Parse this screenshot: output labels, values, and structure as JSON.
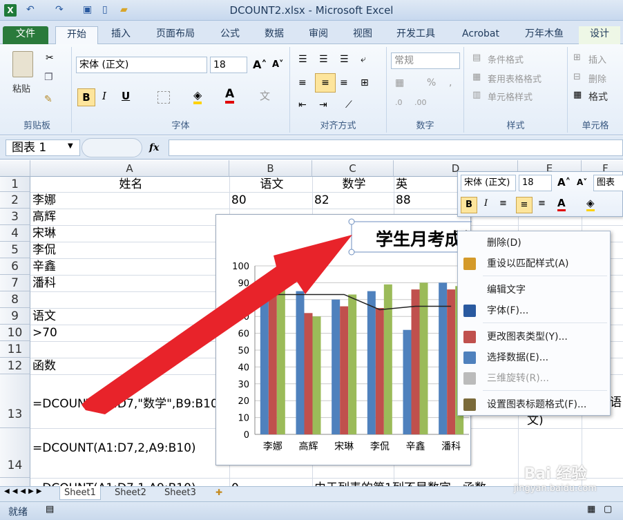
{
  "window": {
    "title": "DCOUNT2.xlsx - Microsoft Excel"
  },
  "tabs": [
    "文件",
    "开始",
    "插入",
    "页面布局",
    "公式",
    "数据",
    "审阅",
    "视图",
    "开发工具",
    "Acrobat",
    "万年木鱼",
    "设计"
  ],
  "ribbon": {
    "clipboard": {
      "label": "剪贴板",
      "paste": "粘贴"
    },
    "font": {
      "label": "字体",
      "name": "宋体 (正文)",
      "size": "18",
      "bold": "B",
      "italic": "I",
      "underline": "U"
    },
    "alignment": {
      "label": "对齐方式"
    },
    "number": {
      "label": "数字",
      "format": "常规"
    },
    "styles": {
      "label": "样式",
      "cond": "条件格式",
      "table": "套用表格格式",
      "cell": "单元格样式"
    },
    "cells": {
      "label": "单元格",
      "insert": "插入",
      "delete": "删除",
      "format": "格式"
    }
  },
  "formula_bar": {
    "name_box": "图表 1",
    "fx": "fx",
    "value": ""
  },
  "columns": [
    "A",
    "B",
    "C",
    "D",
    "E",
    "F"
  ],
  "rows": [
    {
      "n": "1",
      "a": "姓名",
      "b": "语文",
      "c": "数学",
      "d": "英"
    },
    {
      "n": "2",
      "a": "李娜",
      "b": "80",
      "c": "82",
      "d": "88"
    },
    {
      "n": "3",
      "a": "高辉"
    },
    {
      "n": "4",
      "a": "宋琳"
    },
    {
      "n": "5",
      "a": "李侃"
    },
    {
      "n": "6",
      "a": "辛鑫"
    },
    {
      "n": "7",
      "a": "潘科"
    },
    {
      "n": "8",
      "a": ""
    },
    {
      "n": "9",
      "a": "语文"
    },
    {
      "n": "10",
      "a": ">70"
    },
    {
      "n": "11",
      "a": ""
    },
    {
      "n": "12",
      "a": "函数"
    },
    {
      "n": "13",
      "a": "=DCOUNT(A1:D7,\"数学\",B9:B10"
    },
    {
      "n": "14",
      "a": "=DCOUNT(A1:D7,2,A9:B10)"
    },
    {
      "n": "",
      "a": "=DCOUNT(A1:D7,1,A9:B10)",
      "b": "0",
      "c": "由于列表的第1列不是数字，函数"
    }
  ],
  "side_text": {
    "e13": "语",
    "e14": "文)"
  },
  "chart_data": {
    "type": "bar",
    "title": "学生月考成绩",
    "categories": [
      "李娜",
      "高辉",
      "宋琳",
      "李侃",
      "辛鑫",
      "潘科"
    ],
    "series": [
      {
        "color": "#4f81bd",
        "values": [
          81,
          85,
          80,
          85,
          62,
          90
        ]
      },
      {
        "color": "#c0504d",
        "values": [
          83,
          72,
          76,
          75,
          86,
          86
        ]
      },
      {
        "color": "#9bbb59",
        "values": [
          86,
          70,
          83,
          89,
          90,
          88
        ]
      }
    ],
    "line": {
      "color": "#222222",
      "values": [
        83,
        83,
        83,
        74,
        76,
        76
      ]
    },
    "ylim": [
      0,
      100
    ],
    "yticks": [
      "0",
      "10",
      "20",
      "30",
      "40",
      "50",
      "60",
      "70",
      "80",
      "90",
      "100"
    ],
    "grid": true
  },
  "mini_toolbar": {
    "font": "宋体 (正文)",
    "size": "18",
    "extra": "图表标"
  },
  "context_menu": [
    {
      "label": "删除(D)",
      "icon": "",
      "enabled": true
    },
    {
      "label": "重设以匹配样式(A)",
      "icon": "reset-icon",
      "enabled": true
    },
    {
      "label": "编辑文字",
      "icon": "",
      "enabled": true
    },
    {
      "label": "字体(F)...",
      "icon": "font-icon",
      "enabled": true
    },
    {
      "label": "更改图表类型(Y)...",
      "icon": "chart-type-icon",
      "enabled": true
    },
    {
      "label": "选择数据(E)...",
      "icon": "select-data-icon",
      "enabled": true
    },
    {
      "label": "三维旋转(R)...",
      "icon": "rotate-icon",
      "enabled": false
    },
    {
      "label": "设置图表标题格式(F)...",
      "icon": "format-title-icon",
      "enabled": true
    }
  ],
  "sheet_tabs": [
    "Sheet1",
    "Sheet2",
    "Sheet3"
  ],
  "status": {
    "ready": "就绪"
  },
  "watermark": {
    "text": "Bai 经验",
    "url": "jingyan.baidu.com"
  }
}
